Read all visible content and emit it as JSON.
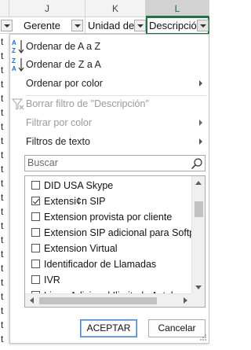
{
  "sheet": {
    "column_letters": [
      "J",
      "K",
      "L"
    ],
    "headers": [
      "Gerente",
      "Unidad de",
      "Descripció"
    ],
    "row_stubs": [
      "t",
      "t",
      "t",
      "t",
      "t",
      "t",
      "t",
      "t",
      "t",
      "t",
      "t",
      "t",
      "t",
      "t",
      "t",
      "t",
      "t",
      "t",
      "t",
      "t",
      "t",
      "t",
      "t"
    ]
  },
  "menu": {
    "sort_az": "Ordenar de A a Z",
    "sort_za": "Ordenar de Z a A",
    "sort_color": "Ordenar por color",
    "clear_filter": "Borrar filtro de \"Descripción\"",
    "filter_color": "Filtrar por color",
    "text_filters": "Filtros de texto"
  },
  "search": {
    "placeholder": "Buscar"
  },
  "list": {
    "items": [
      {
        "label": "DID USA Skype",
        "checked": false
      },
      {
        "label": "Extensi¢n SIP",
        "checked": true
      },
      {
        "label": "Extension provista por cliente",
        "checked": false
      },
      {
        "label": "Extension SIP adicional para Softph",
        "checked": false
      },
      {
        "label": "Extension Virtual",
        "checked": false
      },
      {
        "label": "Identificador de Llamadas",
        "checked": false
      },
      {
        "label": "IVR",
        "checked": false
      },
      {
        "label": "Linea Adicional Ilimitada Axtel",
        "checked": false
      }
    ]
  },
  "buttons": {
    "ok": "ACEPTAR",
    "cancel": "Cancelar"
  },
  "colors": {
    "accent": "#217346",
    "disabled_text": "#9b9b9b",
    "sort_icon_blue": "#1f6fbf"
  }
}
